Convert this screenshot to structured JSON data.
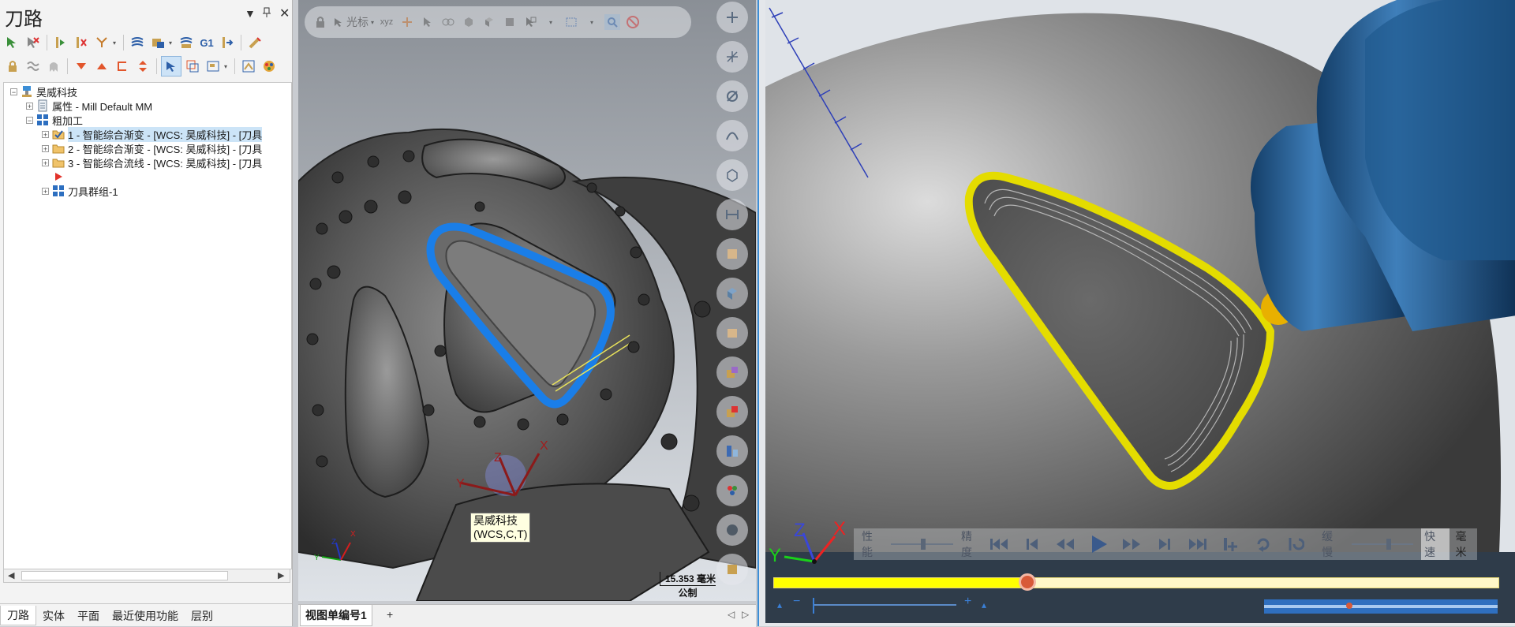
{
  "panel": {
    "title": "刀路",
    "tree": {
      "root": "昊威科技",
      "properties": "属性 - Mill Default MM",
      "group": "粗加工",
      "ops": [
        "1 - 智能综合渐变 - [WCS: 昊威科技] - [刀具",
        "2 - 智能综合渐变 - [WCS: 昊威科技] - [刀具",
        "3 - 智能综合流线 - [WCS: 昊威科技] - [刀具"
      ],
      "toolgroup": "刀具群组-1"
    },
    "tabs": [
      "刀路",
      "实体",
      "平面",
      "最近使用功能",
      "层别"
    ]
  },
  "viewport": {
    "toolbar_cursor_label": "光标",
    "toolbar_xyz_label": "xyz",
    "wcs_tooltip_line1": "昊威科技",
    "wcs_tooltip_line2": "(WCS,C,T)",
    "scale_value": "15.353 毫米",
    "scale_unit": "公制",
    "axis_x": "X",
    "axis_y": "Y",
    "axis_z": "Z",
    "tab": "视图单编号1",
    "add_tab": "+"
  },
  "simulator": {
    "performance_label": "性能",
    "precision_label": "精度",
    "slow_label": "缓慢",
    "fast_label": "快速",
    "unit_label": "毫米",
    "progress": 0.35,
    "colors": {
      "toolpath_blue": "#1a7ee8",
      "toolpath_yellow": "#e4dc00",
      "tool_blue": "#1f5a8f",
      "progress_yellow": "#ffff00",
      "knob": "#d85a38"
    }
  }
}
